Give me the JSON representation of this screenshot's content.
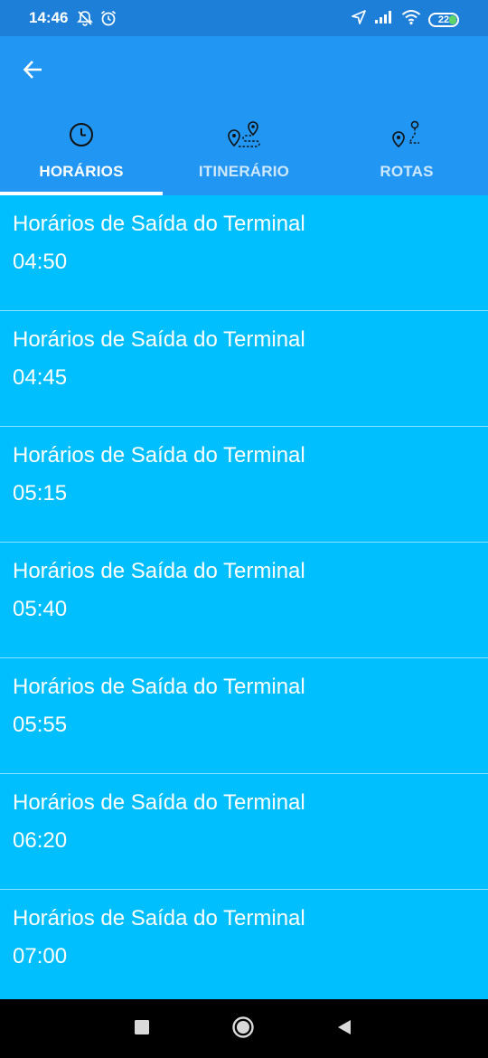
{
  "status_bar": {
    "time": "14:46",
    "battery": "22",
    "icons": [
      "muted-notifications-icon",
      "alarm-icon",
      "location-arrow-icon",
      "signal-icon",
      "wifi-icon",
      "battery-icon"
    ]
  },
  "header": {
    "back_icon": "arrow-left-icon",
    "tabs": [
      {
        "label": "HORÁRIOS",
        "icon": "clock-icon",
        "active": true
      },
      {
        "label": "ITINERÁRIO",
        "icon": "itinerary-icon",
        "active": false
      },
      {
        "label": "ROTAS",
        "icon": "route-pin-icon",
        "active": false
      }
    ]
  },
  "schedule": [
    {
      "title": "Horários de Saída do Terminal",
      "time": "04:50"
    },
    {
      "title": "Horários de Saída do Terminal",
      "time": "04:45"
    },
    {
      "title": "Horários de Saída do Terminal",
      "time": "05:15"
    },
    {
      "title": "Horários de Saída do Terminal",
      "time": "05:40"
    },
    {
      "title": "Horários de Saída do Terminal",
      "time": "05:55"
    },
    {
      "title": "Horários de Saída do Terminal",
      "time": "06:20"
    },
    {
      "title": "Horários de Saída do Terminal",
      "time": "07:00"
    }
  ],
  "colors": {
    "status_bar": "#1E7FD8",
    "header": "#2196F3",
    "list_background": "#00BFFF",
    "nav_bar": "#000000"
  },
  "nav_bar": {
    "icons": [
      "recent-apps-icon",
      "home-icon",
      "back-triangle-icon"
    ]
  }
}
